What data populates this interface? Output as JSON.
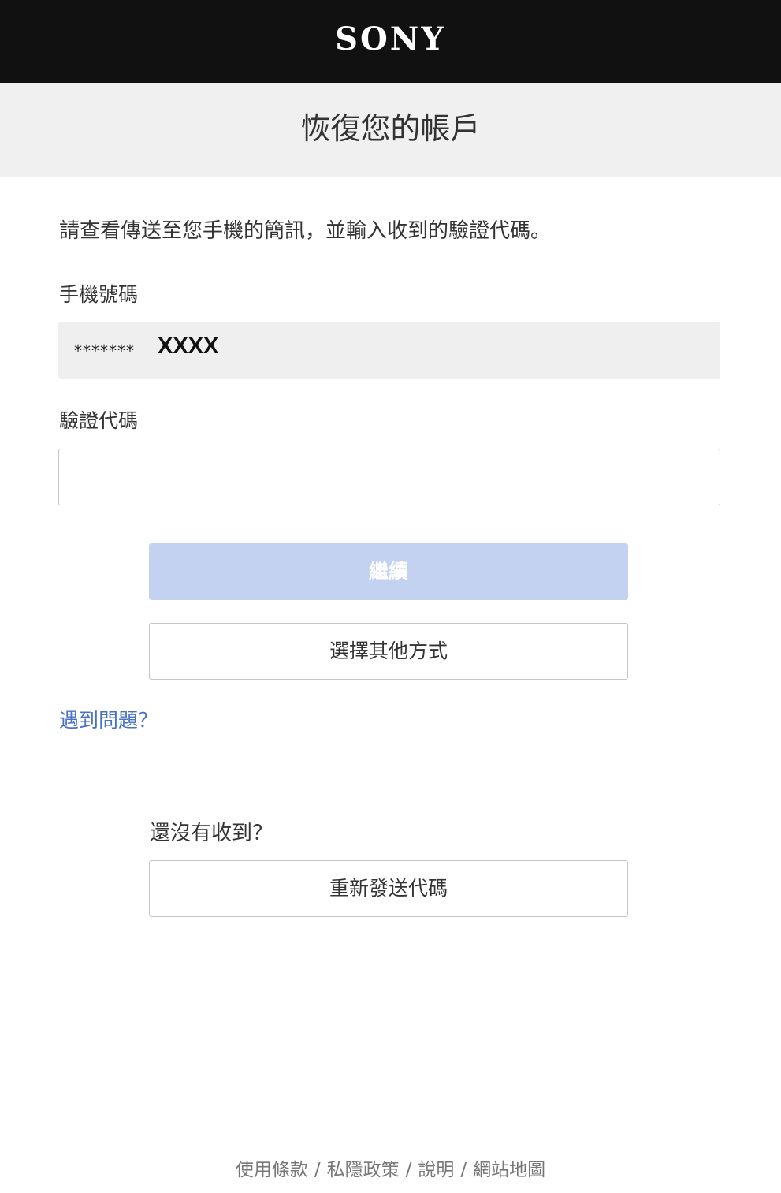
{
  "header": {
    "logo_text": "SONY"
  },
  "page": {
    "title": "恢復您的帳戶",
    "instruction": "請查看傳送至您手機的簡訊，並輸入收到的驗證代碼。"
  },
  "phone": {
    "label": "手機號碼",
    "masked_prefix": "*******",
    "suffix": "XXXX"
  },
  "code": {
    "label": "驗證代碼",
    "value": "",
    "placeholder": ""
  },
  "actions": {
    "continue_label": "繼續",
    "other_method_label": "選擇其他方式",
    "help_link": "遇到問題？"
  },
  "resend": {
    "prompt": "還沒有收到？",
    "button_label": "重新發送代碼"
  },
  "footer": {
    "links": [
      "使用條款",
      "私隱政策",
      "說明",
      "網站地圖"
    ],
    "separator": "/"
  },
  "colors": {
    "header_bg": "#111111",
    "title_band_bg": "#f0f0f0",
    "primary_disabled": "#c4d2f2",
    "link": "#4a72c4"
  }
}
